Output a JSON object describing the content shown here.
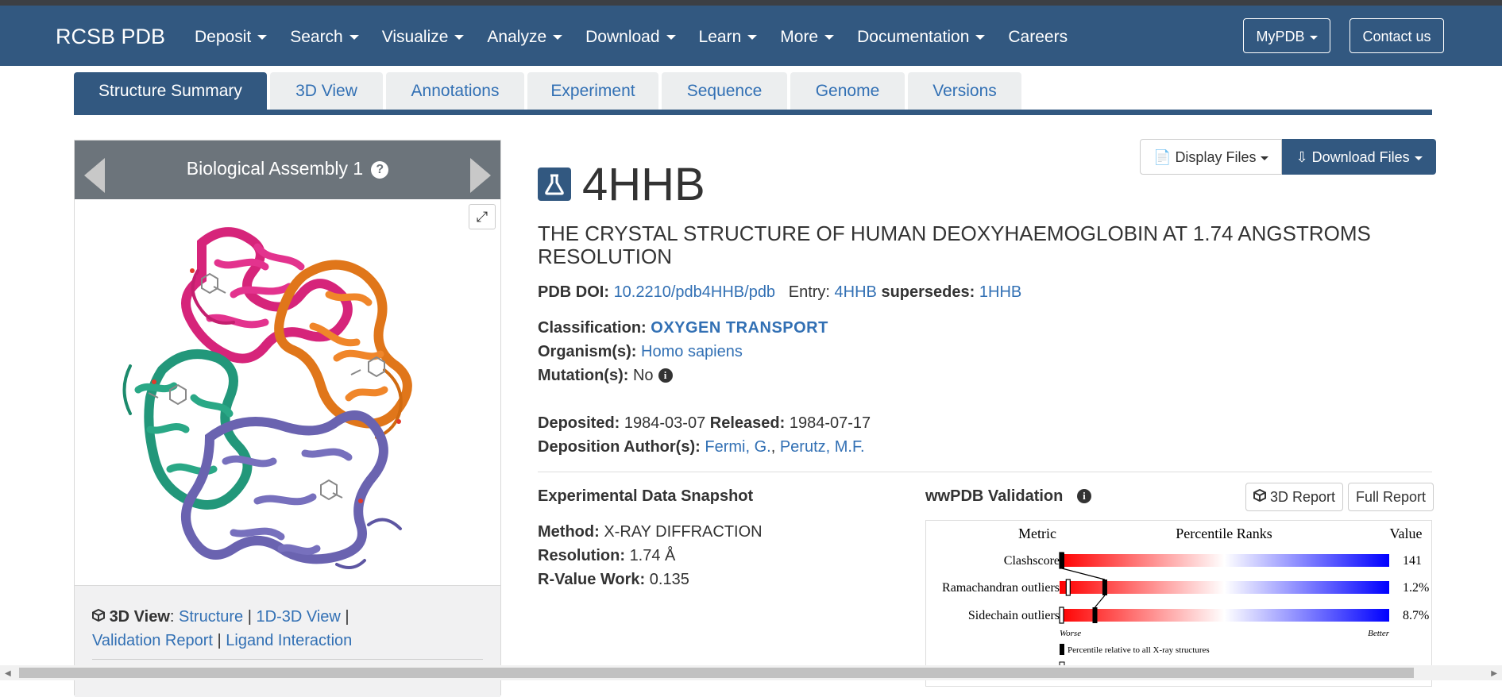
{
  "navbar": {
    "brand": "RCSB PDB",
    "items": [
      {
        "label": "Deposit",
        "dropdown": true
      },
      {
        "label": "Search",
        "dropdown": true
      },
      {
        "label": "Visualize",
        "dropdown": true
      },
      {
        "label": "Analyze",
        "dropdown": true
      },
      {
        "label": "Download",
        "dropdown": true
      },
      {
        "label": "Learn",
        "dropdown": true
      },
      {
        "label": "More",
        "dropdown": true
      },
      {
        "label": "Documentation",
        "dropdown": true
      },
      {
        "label": "Careers",
        "dropdown": false
      }
    ],
    "mypdb_label": "MyPDB",
    "contact_label": "Contact us"
  },
  "tabs": [
    {
      "label": "Structure Summary",
      "active": true
    },
    {
      "label": "3D View",
      "active": false
    },
    {
      "label": "Annotations",
      "active": false
    },
    {
      "label": "Experiment",
      "active": false
    },
    {
      "label": "Sequence",
      "active": false
    },
    {
      "label": "Genome",
      "active": false
    },
    {
      "label": "Versions",
      "active": false
    }
  ],
  "assembly": {
    "title": "Biological Assembly 1",
    "help_icon": "question-circle-icon",
    "prev_icon": "chevron-left-icon",
    "next_icon": "chevron-right-icon",
    "expand_icon": "expand-icon"
  },
  "view_links": {
    "label": "3D View",
    "structure": "Structure",
    "view_1d3d": "1D-3D View",
    "validation_report": "Validation Report",
    "ligand_interaction": "Ligand Interaction",
    "separator": "|"
  },
  "file_buttons": {
    "display_files": "Display Files",
    "download_files": "Download Files"
  },
  "entry": {
    "id": "4HHB",
    "icon": "flask-icon",
    "title": "THE CRYSTAL STRUCTURE OF HUMAN DEOXYHAEMOGLOBIN AT 1.74 ANGSTROMS RESOLUTION",
    "doi_label": "PDB DOI:",
    "doi": "10.2210/pdb4HHB/pdb",
    "entry_label": "Entry:",
    "entry_link": "4HHB",
    "supersedes_label": "supersedes:",
    "supersedes": "1HHB",
    "classification_label": "Classification:",
    "classification": "OXYGEN TRANSPORT",
    "organism_label": "Organism(s):",
    "organism": "Homo sapiens",
    "mutation_label": "Mutation(s):",
    "mutation": "No",
    "deposited_label": "Deposited:",
    "deposited": "1984-03-07",
    "released_label": "Released:",
    "released": "1984-07-17",
    "authors_label": "Deposition Author(s):",
    "authors": [
      "Fermi, G.",
      "Perutz, M.F."
    ]
  },
  "snapshot": {
    "title": "Experimental Data Snapshot",
    "method_label": "Method:",
    "method": "X-RAY DIFFRACTION",
    "resolution_label": "Resolution:",
    "resolution": "1.74 Å",
    "rvalue_label": "R-Value Work:",
    "rvalue": "0.135"
  },
  "validation": {
    "title": "wwPDB Validation",
    "report_3d": "3D Report",
    "full_report": "Full Report",
    "header_metric": "Metric",
    "header_ranks": "Percentile Ranks",
    "header_value": "Value",
    "worse_label": "Worse",
    "better_label": "Better",
    "legend_text": "Percentile relative to all X-ray structures",
    "metrics": [
      {
        "name": "Clashscore",
        "value": "141",
        "percentile_all": 0.0,
        "percentile_res": 0.0
      },
      {
        "name": "Ramachandran outliers",
        "value": "1.2%",
        "percentile_all": 0.13,
        "percentile_res": 0.02
      },
      {
        "name": "Sidechain outliers",
        "value": "8.7%",
        "percentile_all": 0.1,
        "percentile_res": 0.0
      }
    ]
  }
}
